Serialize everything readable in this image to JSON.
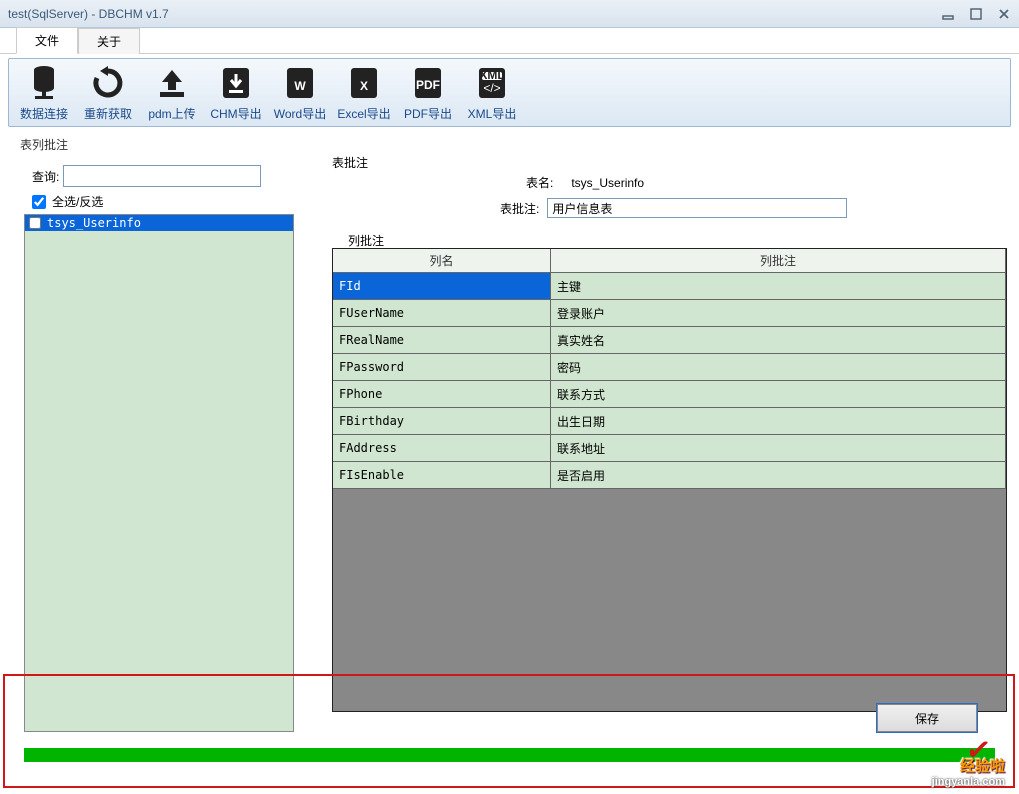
{
  "window": {
    "title": "test(SqlServer) - DBCHM v1.7"
  },
  "tabs": {
    "file": "文件",
    "about": "关于"
  },
  "toolbar": {
    "db_connect": "数据连接",
    "refresh": "重新获取",
    "pdm_upload": "pdm上传",
    "chm_export": "CHM导出",
    "word_export": "Word导出",
    "excel_export": "Excel导出",
    "pdf_export": "PDF导出",
    "xml_export": "XML导出"
  },
  "left": {
    "group_label": "表列批注",
    "query_label": "查询:",
    "query_value": "",
    "selectall_label": "全选/反选",
    "selectall_checked": true,
    "tables": [
      {
        "name": "tsys_Userinfo",
        "checked": false,
        "selected": true
      }
    ]
  },
  "right": {
    "table_group_label": "表批注",
    "table_name_label": "表名:",
    "table_name_value": "tsys_Userinfo",
    "table_comment_label": "表批注:",
    "table_comment_value": "用户信息表",
    "col_group_label": "列批注",
    "col_headers": {
      "name": "列名",
      "comment": "列批注"
    },
    "columns": [
      {
        "name": "FId",
        "comment": "主键",
        "selected": true
      },
      {
        "name": "FUserName",
        "comment": "登录账户"
      },
      {
        "name": "FRealName",
        "comment": "真实姓名"
      },
      {
        "name": "FPassword",
        "comment": "密码"
      },
      {
        "name": "FPhone",
        "comment": "联系方式"
      },
      {
        "name": "FBirthday",
        "comment": "出生日期"
      },
      {
        "name": "FAddress",
        "comment": "联系地址"
      },
      {
        "name": "FIsEnable",
        "comment": "是否启用"
      }
    ]
  },
  "save_button": "保存",
  "watermark": {
    "line1": "经验啦",
    "line2": "jingyanla.com"
  }
}
